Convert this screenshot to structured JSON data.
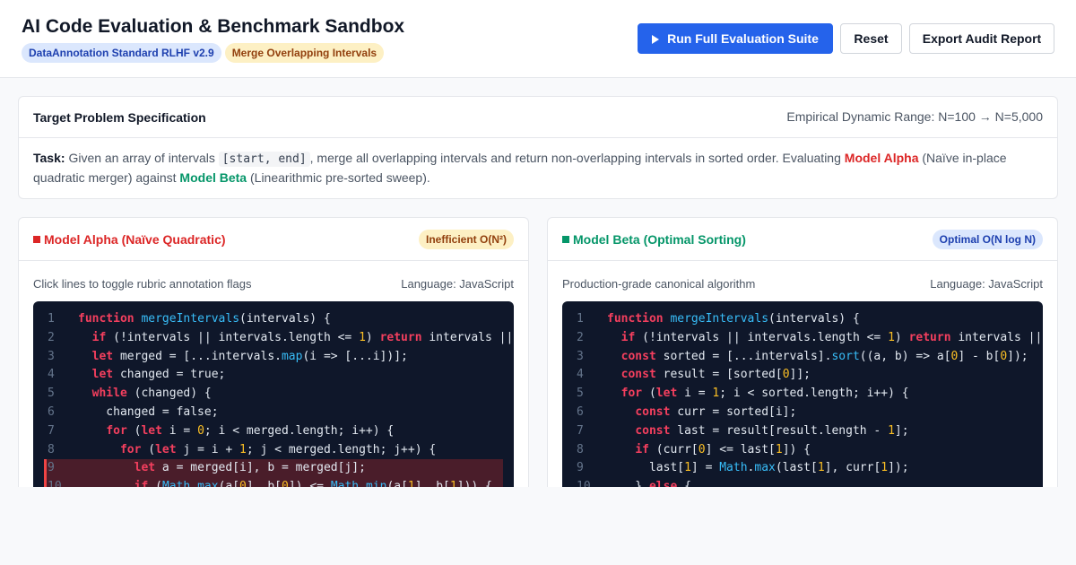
{
  "header": {
    "title": "AI Code Evaluation & Benchmark Sandbox",
    "badges": [
      "DataAnnotation Standard RLHF v2.9",
      "Merge Overlapping Intervals"
    ],
    "buttons": {
      "run": "Run Full Evaluation Suite",
      "reset": "Reset",
      "export": "Export Audit Report"
    },
    "run_icon": "play-icon"
  },
  "spec": {
    "title": "Target Problem Specification",
    "range_prefix": "Empirical Dynamic Range: N=100",
    "range_arrow": "→",
    "range_suffix": "N=5,000",
    "task_label": "Task:",
    "task_1": "Given an array of intervals",
    "task_code": "[start, end]",
    "task_2": ", merge all overlapping intervals and return non-overlapping intervals in sorted order. Evaluating",
    "alpha": "Model Alpha",
    "task_3": "(Naïve in-place quadratic merger) against",
    "beta": "Model Beta",
    "task_4": "(Linearithmic pre-sorted sweep)."
  },
  "panels": {
    "alpha": {
      "marker": "■",
      "title": "Model Alpha (Naïve Quadratic)",
      "badge": "Inefficient O(N²)",
      "subtitle": "Click lines to toggle rubric annotation flags",
      "language": "Language: JavaScript",
      "flagged_lines": [
        9,
        10
      ],
      "lines": [
        {
          "n": "1",
          "tokens": [
            [
              "kw",
              "function"
            ],
            [
              "",
              ""
            ],
            [
              "fn",
              "mergeIntervals"
            ],
            [
              "",
              "(intervals) {"
            ]
          ]
        },
        {
          "n": "2",
          "tokens": [
            [
              "",
              "  "
            ],
            [
              "kw",
              "if"
            ],
            [
              "",
              " (!intervals || intervals.length <= "
            ],
            [
              "nm",
              "1"
            ],
            [
              "",
              ") "
            ],
            [
              "kw",
              "return"
            ],
            [
              "",
              " intervals ||"
            ]
          ]
        },
        {
          "n": "3",
          "tokens": [
            [
              "",
              "  "
            ],
            [
              "kw",
              "let"
            ],
            [
              "",
              " merged = [...intervals."
            ],
            [
              "fn",
              "map"
            ],
            [
              "",
              "(i => [...i])];"
            ]
          ]
        },
        {
          "n": "4",
          "tokens": [
            [
              "",
              "  "
            ],
            [
              "kw",
              "let"
            ],
            [
              "",
              " changed = true;"
            ]
          ]
        },
        {
          "n": "5",
          "tokens": [
            [
              "",
              "  "
            ],
            [
              "kw",
              "while"
            ],
            [
              "",
              " (changed) {"
            ]
          ]
        },
        {
          "n": "6",
          "tokens": [
            [
              "",
              "    changed = false;"
            ]
          ]
        },
        {
          "n": "7",
          "tokens": [
            [
              "",
              "    "
            ],
            [
              "kw",
              "for"
            ],
            [
              "",
              " ("
            ],
            [
              "kw",
              "let"
            ],
            [
              "",
              " i = "
            ],
            [
              "nm",
              "0"
            ],
            [
              "",
              "; i < merged.length; i++) {"
            ]
          ]
        },
        {
          "n": "8",
          "tokens": [
            [
              "",
              "      "
            ],
            [
              "kw",
              "for"
            ],
            [
              "",
              " ("
            ],
            [
              "kw",
              "let"
            ],
            [
              "",
              " j = i + "
            ],
            [
              "nm",
              "1"
            ],
            [
              "",
              "; j < merged.length; j++) {"
            ]
          ]
        },
        {
          "n": "9",
          "tokens": [
            [
              "",
              "        "
            ],
            [
              "kw",
              "let"
            ],
            [
              "",
              " a = merged[i], b = merged[j];"
            ]
          ]
        },
        {
          "n": "10",
          "tokens": [
            [
              "",
              "        "
            ],
            [
              "kw",
              "if"
            ],
            [
              "",
              " ("
            ],
            [
              "fn",
              "Math"
            ],
            [
              "",
              "."
            ],
            [
              "fn",
              "max"
            ],
            [
              "",
              "(a["
            ],
            [
              "nm",
              "0"
            ],
            [
              "",
              "], b["
            ],
            [
              "nm",
              "0"
            ],
            [
              "",
              "]) <= "
            ],
            [
              "fn",
              "Math"
            ],
            [
              "",
              "."
            ],
            [
              "fn",
              "min"
            ],
            [
              "",
              "(a["
            ],
            [
              "nm",
              "1"
            ],
            [
              "",
              "], b["
            ],
            [
              "nm",
              "1"
            ],
            [
              "",
              "])) {"
            ]
          ]
        }
      ]
    },
    "beta": {
      "marker": "■",
      "title": "Model Beta (Optimal Sorting)",
      "badge": "Optimal O(N log N)",
      "subtitle": "Production-grade canonical algorithm",
      "language": "Language: JavaScript",
      "flagged_lines": [],
      "lines": [
        {
          "n": "1",
          "tokens": [
            [
              "kw",
              "function"
            ],
            [
              "",
              ""
            ],
            [
              "fn",
              "mergeIntervals"
            ],
            [
              "",
              "(intervals) {"
            ]
          ]
        },
        {
          "n": "2",
          "tokens": [
            [
              "",
              "  "
            ],
            [
              "kw",
              "if"
            ],
            [
              "",
              " (!intervals || intervals.length <= "
            ],
            [
              "nm",
              "1"
            ],
            [
              "",
              ") "
            ],
            [
              "kw",
              "return"
            ],
            [
              "",
              " intervals ||"
            ]
          ]
        },
        {
          "n": "3",
          "tokens": [
            [
              "",
              "  "
            ],
            [
              "kw",
              "const"
            ],
            [
              "",
              " sorted = [...intervals]."
            ],
            [
              "fn",
              "sort"
            ],
            [
              "",
              "((a, b) => a["
            ],
            [
              "nm",
              "0"
            ],
            [
              "",
              "] - b["
            ],
            [
              "nm",
              "0"
            ],
            [
              "",
              "]);"
            ]
          ]
        },
        {
          "n": "4",
          "tokens": [
            [
              "",
              "  "
            ],
            [
              "kw",
              "const"
            ],
            [
              "",
              " result = [sorted["
            ],
            [
              "nm",
              "0"
            ],
            [
              "",
              "]];"
            ]
          ]
        },
        {
          "n": "5",
          "tokens": [
            [
              "",
              "  "
            ],
            [
              "kw",
              "for"
            ],
            [
              "",
              " ("
            ],
            [
              "kw",
              "let"
            ],
            [
              "",
              " i = "
            ],
            [
              "nm",
              "1"
            ],
            [
              "",
              "; i < sorted.length; i++) {"
            ]
          ]
        },
        {
          "n": "6",
          "tokens": [
            [
              "",
              "    "
            ],
            [
              "kw",
              "const"
            ],
            [
              "",
              " curr = sorted[i];"
            ]
          ]
        },
        {
          "n": "7",
          "tokens": [
            [
              "",
              "    "
            ],
            [
              "kw",
              "const"
            ],
            [
              "",
              " last = result[result.length - "
            ],
            [
              "nm",
              "1"
            ],
            [
              "",
              "];"
            ]
          ]
        },
        {
          "n": "8",
          "tokens": [
            [
              "",
              "    "
            ],
            [
              "kw",
              "if"
            ],
            [
              "",
              " (curr["
            ],
            [
              "nm",
              "0"
            ],
            [
              "",
              "] <= last["
            ],
            [
              "nm",
              "1"
            ],
            [
              "",
              "]) {"
            ]
          ]
        },
        {
          "n": "9",
          "tokens": [
            [
              "",
              "      last["
            ],
            [
              "nm",
              "1"
            ],
            [
              "",
              "] = "
            ],
            [
              "fn",
              "Math"
            ],
            [
              "",
              "."
            ],
            [
              "fn",
              "max"
            ],
            [
              "",
              "(last["
            ],
            [
              "nm",
              "1"
            ],
            [
              "",
              "], curr["
            ],
            [
              "nm",
              "1"
            ],
            [
              "",
              "]);"
            ]
          ]
        },
        {
          "n": "10",
          "tokens": [
            [
              "",
              "    } "
            ],
            [
              "kw",
              "else"
            ],
            [
              "",
              " {"
            ]
          ]
        }
      ]
    }
  }
}
